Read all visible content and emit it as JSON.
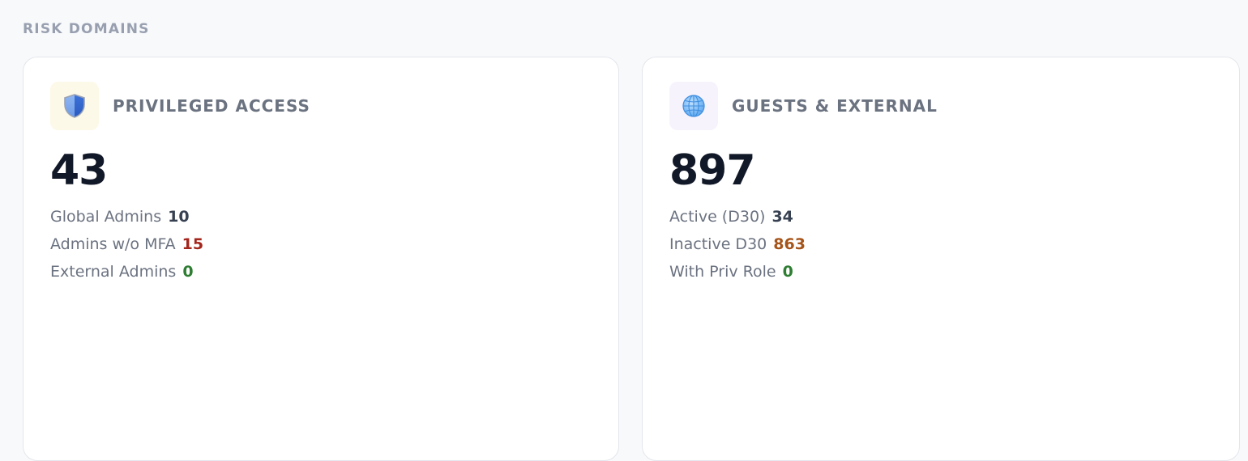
{
  "section": {
    "title": "RISK DOMAINS"
  },
  "cards": [
    {
      "icon": "shield-icon",
      "title": "PRIVILEGED ACCESS",
      "value": "43",
      "stats": [
        {
          "label": "Global Admins",
          "value": "10",
          "color": "#374151"
        },
        {
          "label": "Admins w/o MFA",
          "value": "15",
          "color": "#a3261d"
        },
        {
          "label": "External Admins",
          "value": "0",
          "color": "#2e7d32"
        }
      ]
    },
    {
      "icon": "globe-icon",
      "title": "GUESTS & EXTERNAL",
      "value": "897",
      "stats": [
        {
          "label": "Active (D30)",
          "value": "34",
          "color": "#374151"
        },
        {
          "label": "Inactive D30",
          "value": "863",
          "color": "#a5541a"
        },
        {
          "label": "With Priv Role",
          "value": "0",
          "color": "#2e7d32"
        }
      ]
    }
  ]
}
